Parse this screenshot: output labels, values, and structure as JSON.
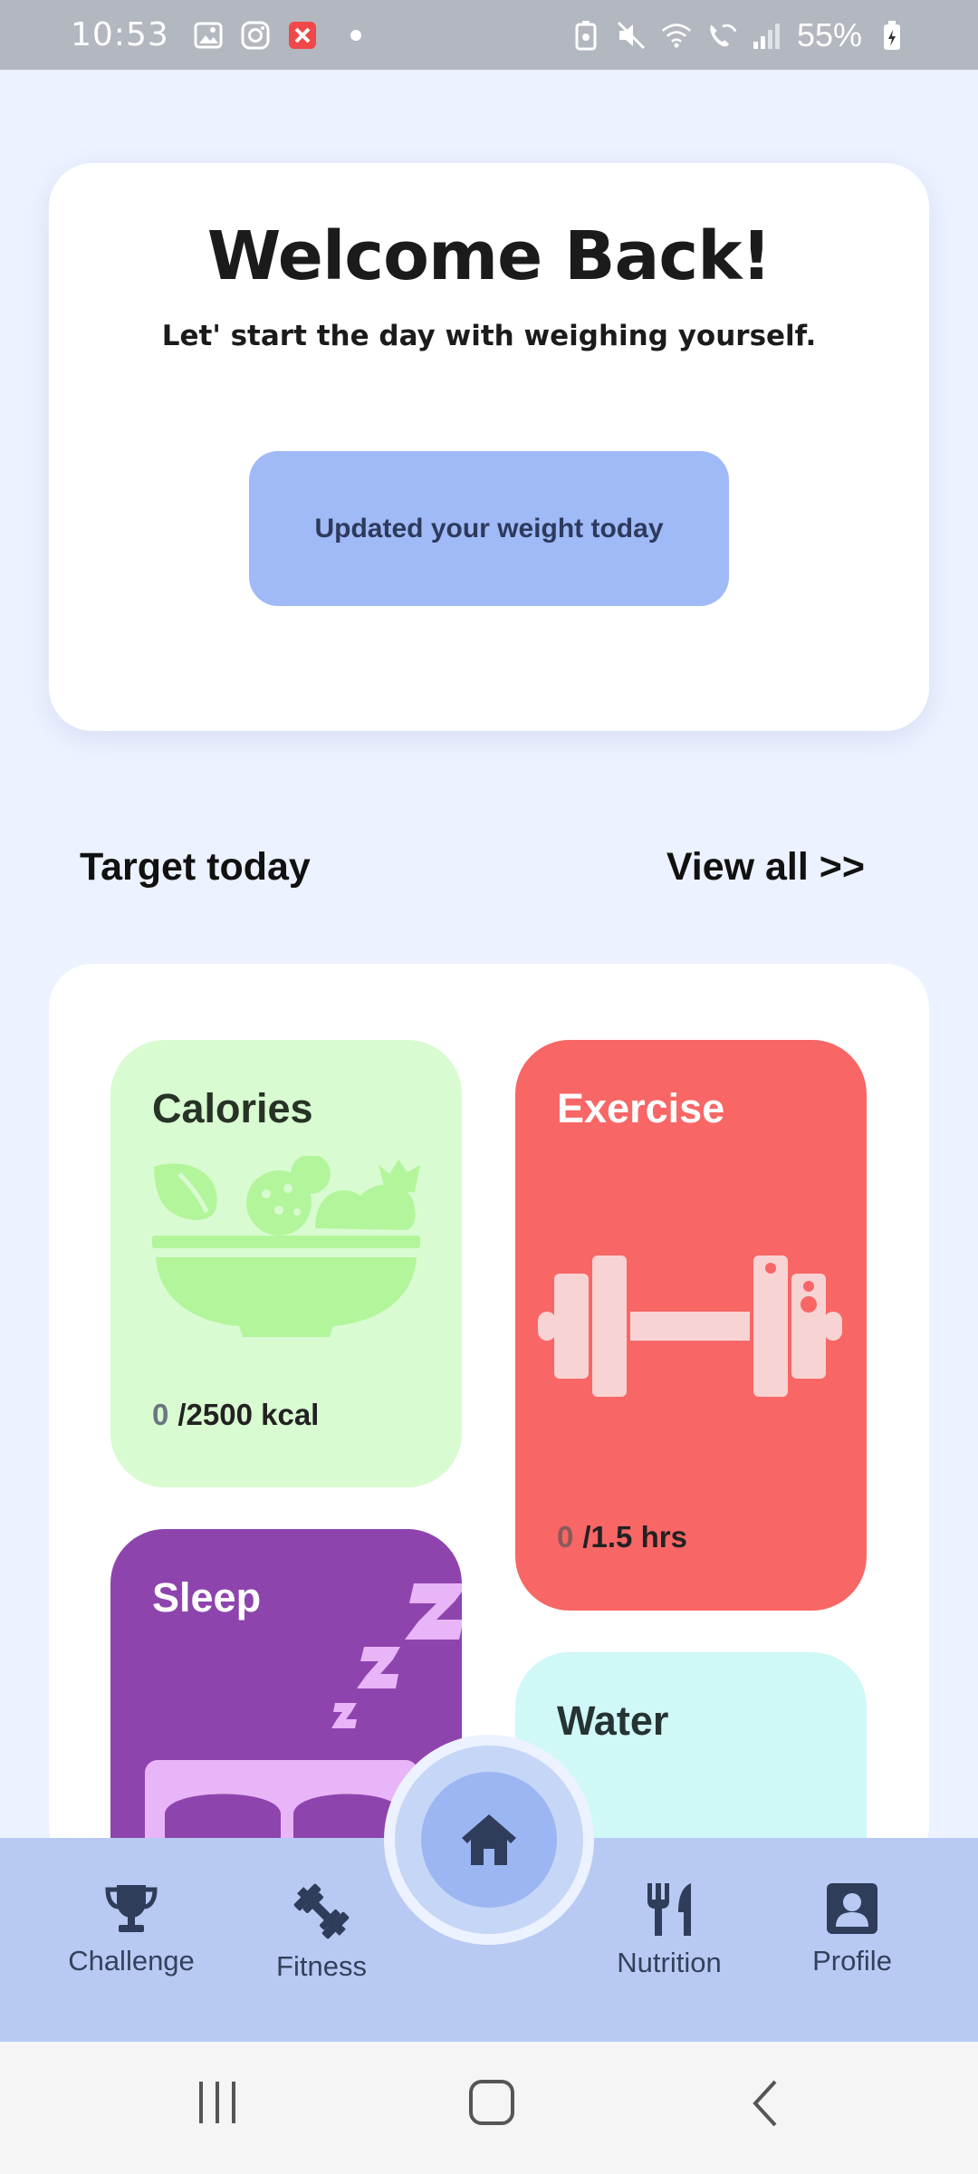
{
  "status_bar": {
    "time": "10:53",
    "battery": "55%"
  },
  "welcome": {
    "title": "Welcome Back!",
    "subtitle": "Let' start the day with weighing yourself.",
    "button_label": "Updated your weight today"
  },
  "targets": {
    "heading": "Target today",
    "view_all": "View all >>",
    "calories": {
      "label": "Calories",
      "current": "0",
      "goal": "/2500 kcal",
      "color": "#d9fbd1"
    },
    "exercise": {
      "label": "Exercise",
      "current": "0",
      "goal": "/1.5 hrs",
      "color": "#f86666"
    },
    "sleep": {
      "label": "Sleep",
      "color": "#8e44ad"
    },
    "water": {
      "label": "Water",
      "color": "#cff8f7"
    }
  },
  "bottom_nav": {
    "items": [
      {
        "label": "Challenge",
        "icon": "trophy-icon"
      },
      {
        "label": "Fitness",
        "icon": "dumbbell-icon"
      },
      {
        "label": "Home",
        "icon": "home-icon"
      },
      {
        "label": "Nutrition",
        "icon": "fork-knife-icon"
      },
      {
        "label": "Profile",
        "icon": "profile-icon"
      }
    ]
  },
  "system_nav": [
    "recents-button",
    "home-button",
    "back-button"
  ]
}
